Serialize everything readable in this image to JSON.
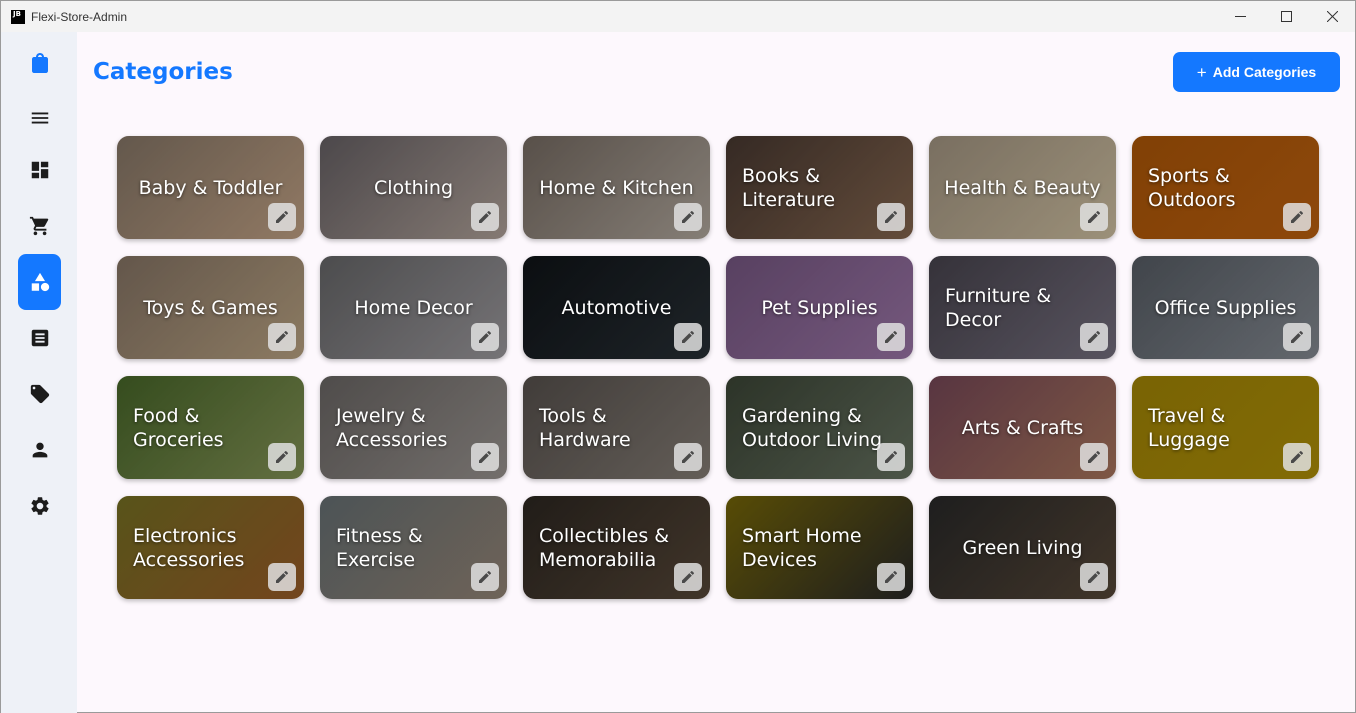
{
  "window": {
    "title": "Flexi-Store-Admin",
    "icon_text": "JB"
  },
  "page": {
    "title": "Categories"
  },
  "add_button": {
    "icon": "plus-icon",
    "label": "Add Categories"
  },
  "colors": {
    "accent": "#1478ff",
    "sidebar_bg": "#eef1f7",
    "page_bg": "#fdf8fd"
  },
  "sidebar": {
    "items": [
      {
        "icon": "shopping-bag-icon"
      },
      {
        "icon": "menu-icon"
      },
      {
        "icon": "dashboard-icon"
      },
      {
        "icon": "cart-icon"
      },
      {
        "icon": "categories-icon",
        "active": true
      },
      {
        "icon": "orders-list-icon"
      },
      {
        "icon": "tag-icon"
      },
      {
        "icon": "person-icon"
      },
      {
        "icon": "settings-icon"
      }
    ]
  },
  "categories": [
    {
      "label": "Baby & Toddler",
      "color": "#8a7a6a",
      "color2": "#c9a88a"
    },
    {
      "label": "Clothing",
      "color": "#6a6468",
      "color2": "#b8a9a0"
    },
    {
      "label": "Home & Kitchen",
      "color": "#7a6f66",
      "color2": "#b9afa4"
    },
    {
      "label": "Books & Literature",
      "color": "#4a3a32",
      "color2": "#8a6a52"
    },
    {
      "label": "Health & Beauty",
      "color": "#a89a86",
      "color2": "#d8c8a8"
    },
    {
      "label": "Sports & Outdoors",
      "color": "#b35a08",
      "color2": "#c46410"
    },
    {
      "label": "Toys & Games",
      "color": "#8a7868",
      "color2": "#c2aa88"
    },
    {
      "label": "Home Decor",
      "color": "#6a6a6c",
      "color2": "#a3a0a4"
    },
    {
      "label": "Automotive",
      "color": "#101418",
      "color2": "#2a3238"
    },
    {
      "label": "Pet Supplies",
      "color": "#7a5a86",
      "color2": "#a27aae"
    },
    {
      "label": "Furniture & Decor",
      "color": "#4a4650",
      "color2": "#7a7484"
    },
    {
      "label": "Office Supplies",
      "color": "#5a6068",
      "color2": "#8a9098"
    },
    {
      "label": "Food & Groceries",
      "color": "#4a6a2a",
      "color2": "#8a9a5a"
    },
    {
      "label": "Jewelry & Accessories",
      "color": "#6e6a68",
      "color2": "#a09a96"
    },
    {
      "label": "Tools & Hardware",
      "color": "#5a5450",
      "color2": "#8a827a"
    },
    {
      "label": "Gardening & Outdoor Living",
      "color": "#3e4838",
      "color2": "#6a7664"
    },
    {
      "label": "Arts & Crafts",
      "color": "#7a4a5a",
      "color2": "#b07a60"
    },
    {
      "label": "Travel & Luggage",
      "color": "#a88a06",
      "color2": "#b59508"
    },
    {
      "label": "Electronics Accessories",
      "color": "#7a7424",
      "color2": "#a0602a"
    },
    {
      "label": "Fitness & Exercise",
      "color": "#6a7478",
      "color2": "#9a8a7a"
    },
    {
      "label": "Collectibles & Memorabilia",
      "color": "#2e2822",
      "color2": "#5a4a3a"
    },
    {
      "label": "Smart Home Devices",
      "color": "#7a6a08",
      "color2": "#2a2a2a"
    },
    {
      "label": "Green Living",
      "color": "#2a2a2a",
      "color2": "#5a4a3a"
    }
  ]
}
